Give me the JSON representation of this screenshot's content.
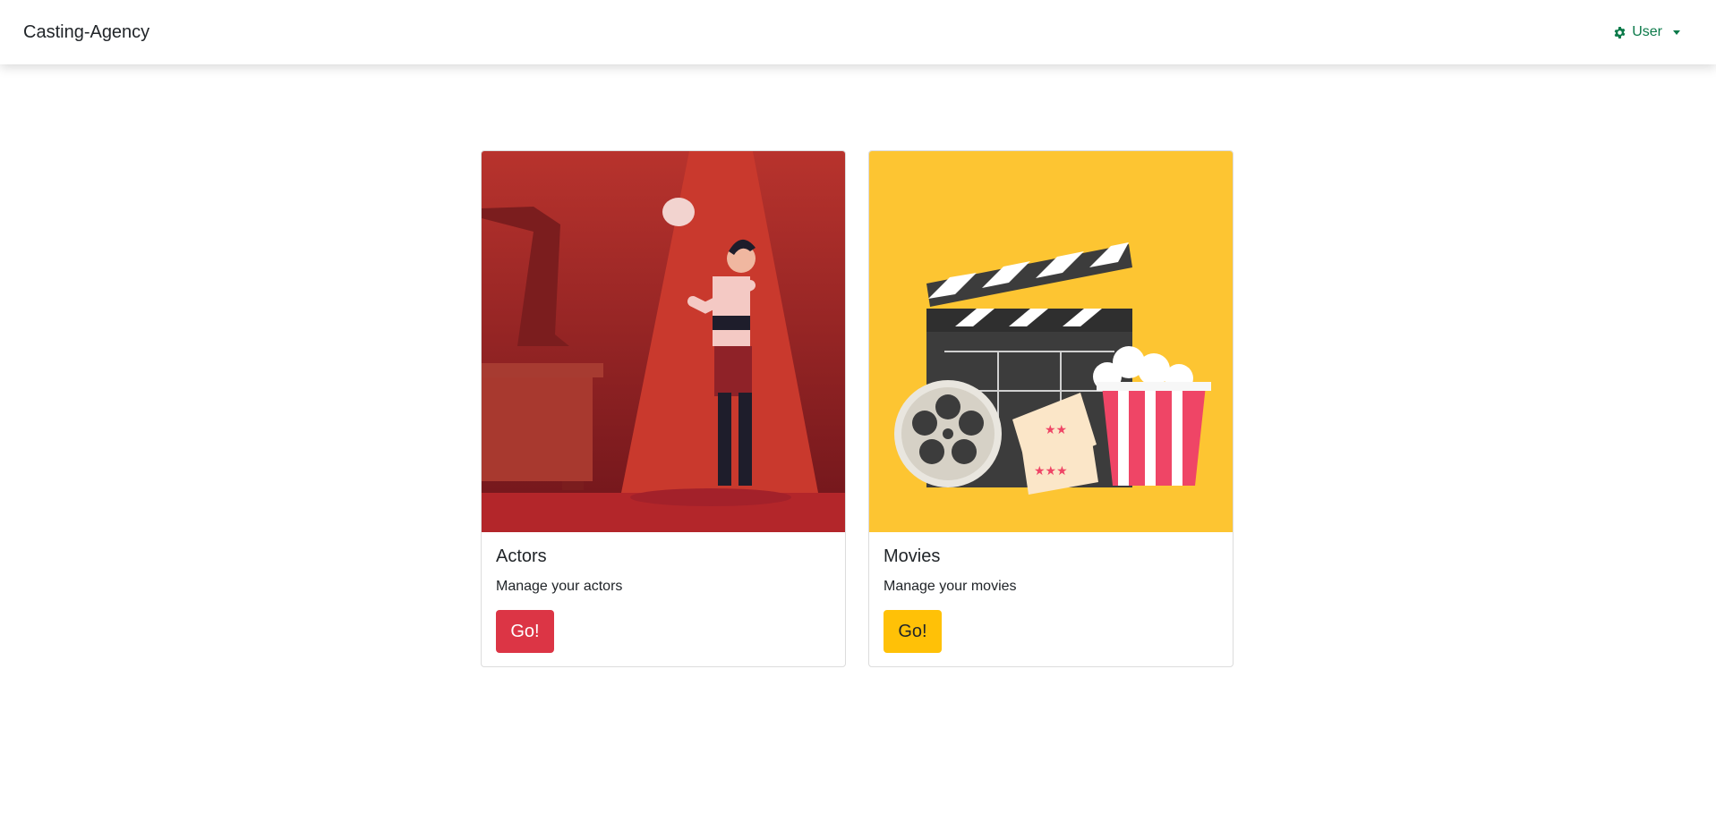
{
  "navbar": {
    "brand": "Casting-Agency",
    "user_label": "User",
    "user_icon": "gear-icon"
  },
  "cards": [
    {
      "title": "Actors",
      "text": "Manage your actors",
      "button": "Go!",
      "button_color": "#dc3545",
      "image": "actor-with-skull-on-stage"
    },
    {
      "title": "Movies",
      "text": "Manage your movies",
      "button": "Go!",
      "button_color": "#ffc107",
      "image": "clapperboard-film-reel-tickets-popcorn"
    }
  ],
  "colors": {
    "accent_green": "#0c7a4a",
    "stage_red": "#b3262a",
    "movie_yellow": "#fdc532"
  }
}
